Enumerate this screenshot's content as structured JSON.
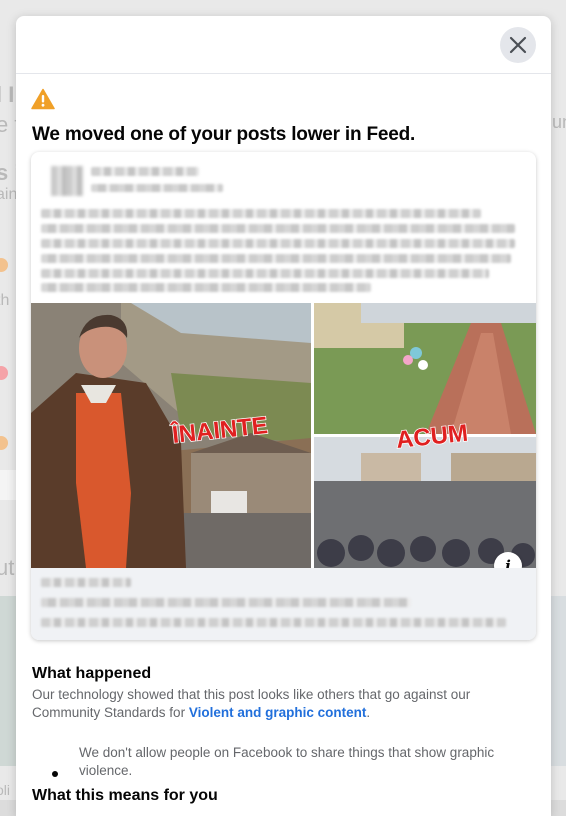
{
  "background": {
    "fragments": [
      "l I",
      "e t",
      "s i",
      "ain",
      "th",
      "ut",
      "oli",
      "un"
    ]
  },
  "modal": {
    "close_icon": "close-icon",
    "warning_icon": "warning-triangle-icon",
    "title": "We moved one of your posts lower in Feed.",
    "post": {
      "image_overlay_left": "ÎNAINTE",
      "image_overlay_right": "ACUM",
      "info_icon": "info-icon",
      "info_glyph": "i"
    },
    "what_happened": {
      "heading": "What happened",
      "text_before_link": "Our technology showed that this post looks like others that go against our Community Standards for ",
      "link": "Violent and graphic content",
      "text_after_link": ".",
      "bullet": "We don't allow people on Facebook to share things that show graphic violence."
    },
    "what_this_means": {
      "heading": "What this means for you"
    }
  },
  "colors": {
    "accent": "#216fdb",
    "warning": "#f0a028",
    "title_text": "#050505",
    "body_text": "#65676b",
    "overlay_text": "#e02020"
  }
}
